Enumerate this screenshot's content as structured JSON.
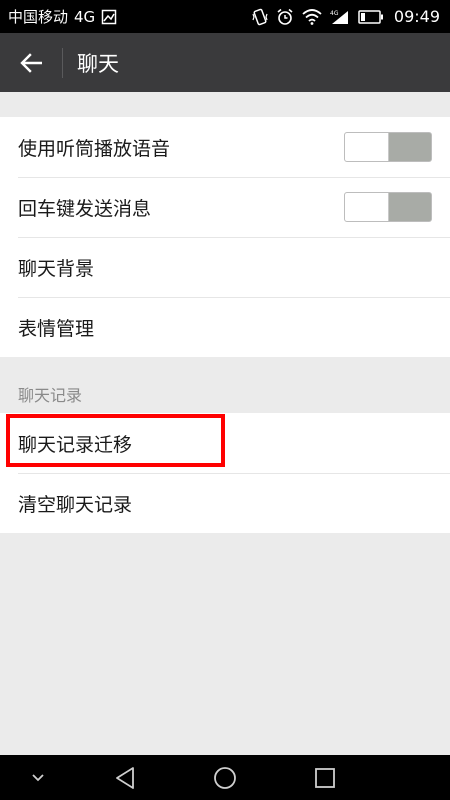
{
  "status_bar": {
    "carrier": "中国移动",
    "network": "4G",
    "time": "09:49"
  },
  "app_bar": {
    "title": "聊天"
  },
  "chat_settings": {
    "items": [
      {
        "label": "使用听筒播放语音",
        "toggle": "off"
      },
      {
        "label": "回车键发送消息",
        "toggle": "off"
      },
      {
        "label": "聊天背景"
      },
      {
        "label": "表情管理"
      }
    ]
  },
  "chat_records": {
    "header": "聊天记录",
    "items": [
      {
        "label": "聊天记录迁移"
      },
      {
        "label": "清空聊天记录"
      }
    ]
  },
  "colors": {
    "status_bar_bg": "#000000",
    "app_bar_bg": "#3a3a3c",
    "page_bg": "#ebebeb",
    "highlight": "#ff0000"
  },
  "icons": {
    "back": "arrow-left-icon",
    "nav_collapse": "chevron-down-icon",
    "nav_back": "triangle-back-icon",
    "nav_home": "circle-home-icon",
    "nav_recent": "square-recent-icon"
  }
}
